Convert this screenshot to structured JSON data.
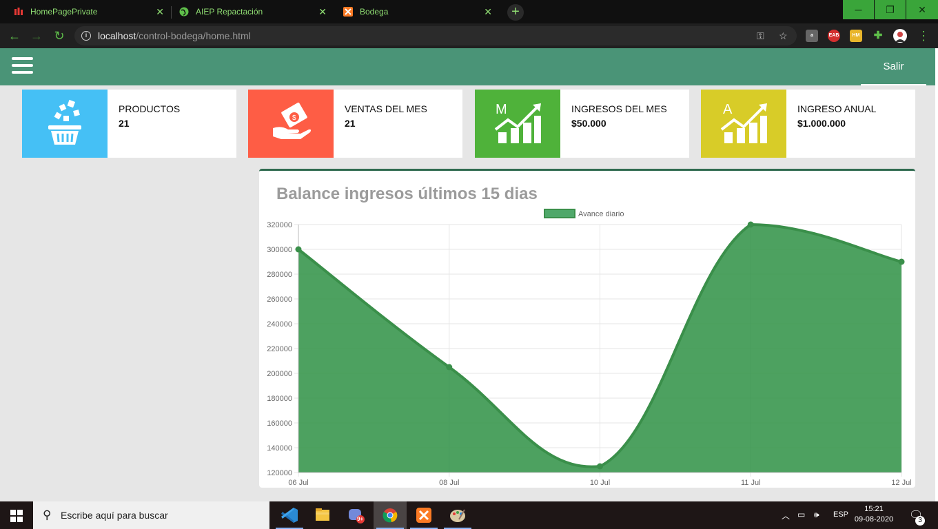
{
  "browser": {
    "tabs": [
      {
        "label": "HomePagePrivate",
        "icon": "bars-icon"
      },
      {
        "label": "AIEP Repactación",
        "icon": "globe-icon"
      },
      {
        "label": "Bodega",
        "icon": "xampp-icon"
      }
    ],
    "url_host": "localhost",
    "url_path": "/control-bodega/home.html"
  },
  "navbar": {
    "salir_label": "Salir"
  },
  "cards": [
    {
      "title": "PRODUCTOS",
      "value": "21",
      "color": "#45c0f5",
      "icon": "basket-icon"
    },
    {
      "title": "VENTAS DEL MES",
      "value": "21",
      "color": "#fe5d45",
      "icon": "money-hand-icon"
    },
    {
      "title": "INGRESOS DEL MES",
      "value": "$50.000",
      "color": "#4fb23a",
      "icon": "growth-chart-icon",
      "letter": "M"
    },
    {
      "title": "INGRESO ANUAL",
      "value": "$1.000.000",
      "color": "#d8cc28",
      "icon": "growth-chart-icon",
      "letter": "A"
    }
  ],
  "chart_title": "Balance ingresos últimos 15 dias",
  "chart_data": {
    "type": "area",
    "x": [
      "06 Jul",
      "08 Jul",
      "10 Jul",
      "11 Jul",
      "12 Jul"
    ],
    "series": [
      {
        "name": "Avance diario",
        "values": [
          300000,
          205000,
          125000,
          320000,
          290000
        ],
        "color": "#2e9144"
      }
    ],
    "ylim": [
      120000,
      320000
    ],
    "yticks": [
      120000,
      140000,
      160000,
      180000,
      200000,
      220000,
      240000,
      260000,
      280000,
      300000,
      320000
    ],
    "grid": true,
    "legend": "top-center"
  },
  "taskbar": {
    "search_placeholder": "Escribe aquí para buscar",
    "lang": "ESP",
    "time": "15:21",
    "date": "09-08-2020",
    "notification_count": "3",
    "discord_badge": "9+"
  }
}
